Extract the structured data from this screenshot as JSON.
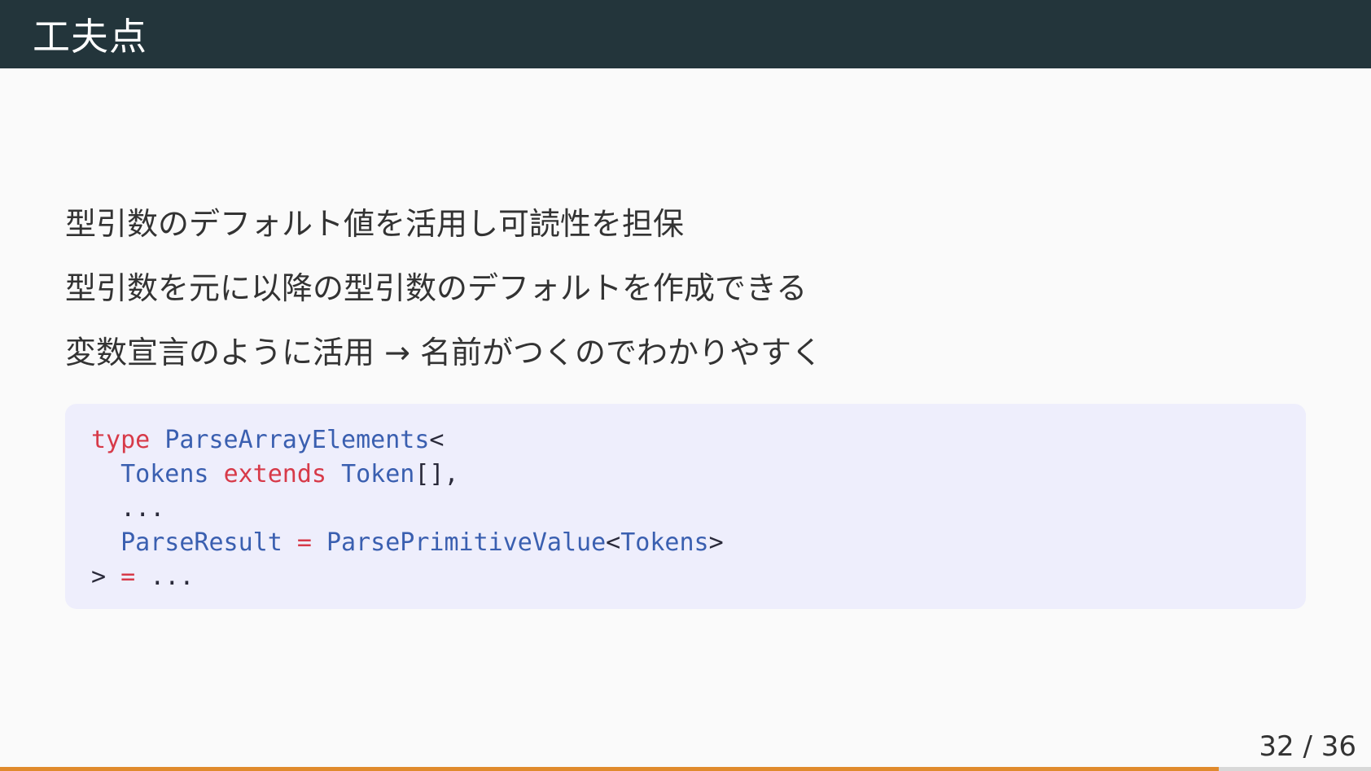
{
  "header": {
    "title": "工夫点"
  },
  "bullets": [
    "型引数のデフォルト値を活用し可読性を担保",
    "型引数を元に以降の型引数のデフォルトを作成できる",
    "変数宣言のように活用 → 名前がつくのでわかりやすく"
  ],
  "code": {
    "line1": {
      "kw": "type",
      "name": "ParseArrayElements",
      "punct": "<"
    },
    "line2": {
      "indent": "  ",
      "param": "Tokens",
      "kw": "extends",
      "type": "Token",
      "punct": "[],"
    },
    "line3": {
      "text": "  ..."
    },
    "line4": {
      "indent": "  ",
      "param": "ParseResult",
      "op": "=",
      "type": "ParsePrimitiveValue",
      "lt": "<",
      "arg": "Tokens",
      "gt": ">"
    },
    "line5": {
      "punct": ">",
      "op": "=",
      "rest": "..."
    }
  },
  "footer": {
    "page_label": "32 / 36",
    "current_page": 32,
    "total_pages": 36,
    "accent_color": "#e08a2c"
  }
}
